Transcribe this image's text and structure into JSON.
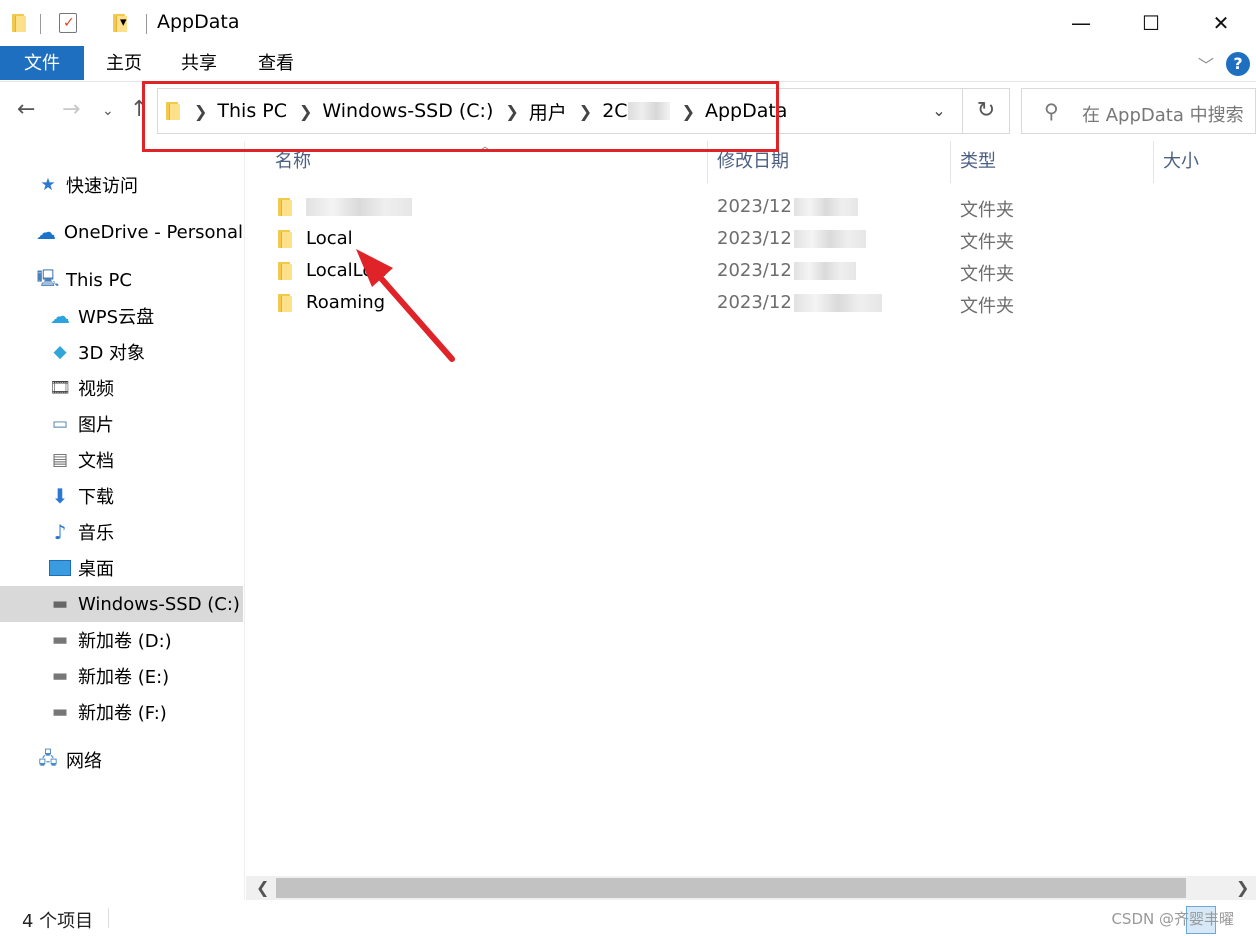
{
  "window": {
    "title": "AppData",
    "minimize": "—",
    "maximize": "☐",
    "close": "✕"
  },
  "ribbon": {
    "tabs": [
      "文件",
      "主页",
      "共享",
      "查看"
    ]
  },
  "address": {
    "crumbs": [
      "This PC",
      "Windows-SSD (C:)",
      "用户",
      "2C",
      "AppData"
    ]
  },
  "search": {
    "placeholder": "在 AppData 中搜索"
  },
  "sidebar": {
    "quick_access": "快速访问",
    "onedrive": "OneDrive - Personal",
    "this_pc": "This PC",
    "items": [
      "WPS云盘",
      "3D 对象",
      "视频",
      "图片",
      "文档",
      "下载",
      "音乐",
      "桌面",
      "Windows-SSD (C:)",
      "新加卷 (D:)",
      "新加卷 (E:)",
      "新加卷 (F:)"
    ],
    "network": "网络",
    "selected": "Windows-SSD (C:)"
  },
  "columns": {
    "name": "名称",
    "modified": "修改日期",
    "type": "类型",
    "size": "大小"
  },
  "files": [
    {
      "name": "",
      "date": "2023/12",
      "type": "文件夹"
    },
    {
      "name": "Local",
      "date": "2023/12",
      "type": "文件夹"
    },
    {
      "name": "LocalLow",
      "date": "2023/12",
      "type": "文件夹"
    },
    {
      "name": "Roaming",
      "date": "2023/12",
      "type": "文件夹"
    }
  ],
  "status": {
    "count": "4 个项目",
    "watermark": "CSDN @齐婴丰曜"
  },
  "colors": {
    "file_tab": "#1e6fc0",
    "highlight_box": "#e02328",
    "folder": "#f2c94c"
  }
}
